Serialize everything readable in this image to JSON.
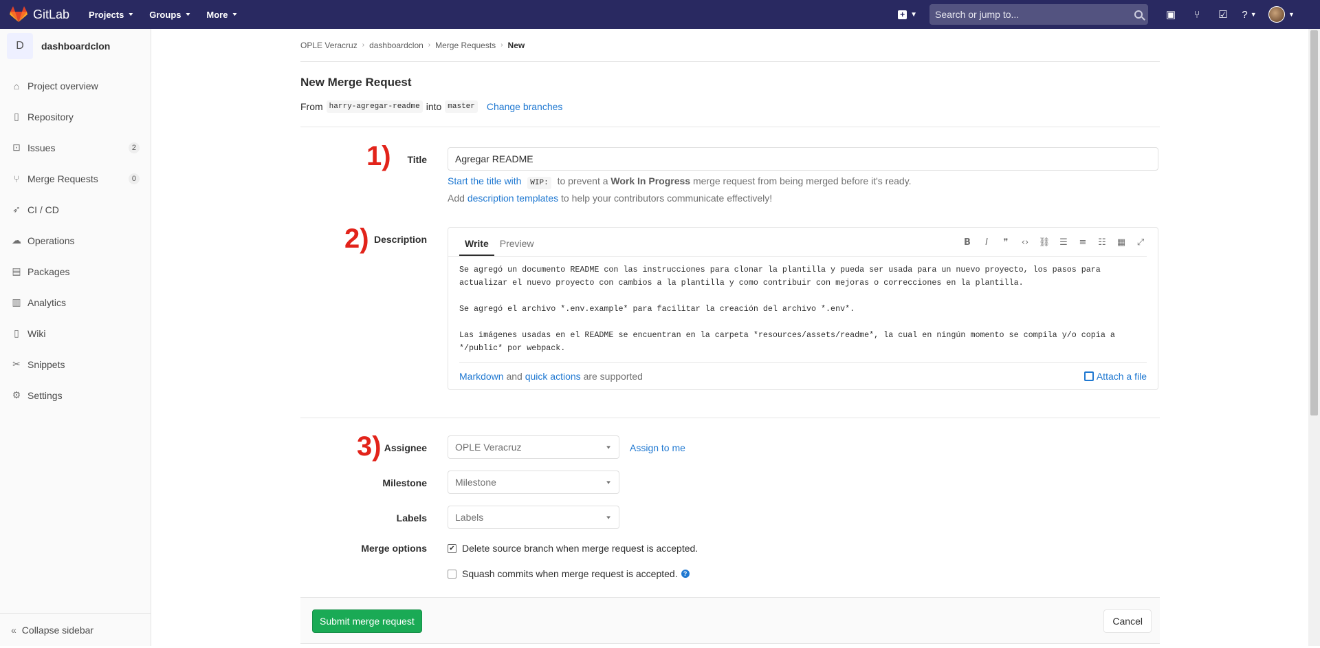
{
  "topbar": {
    "brand": "GitLab",
    "nav": [
      "Projects",
      "Groups",
      "More"
    ],
    "search_placeholder": "Search or jump to...",
    "colors": {
      "navbar": "#292961",
      "brand_orange": "#fc6d26"
    }
  },
  "sidebar": {
    "project_initial": "D",
    "project_name": "dashboardclon",
    "items": [
      {
        "label": "Project overview",
        "icon": "home-icon"
      },
      {
        "label": "Repository",
        "icon": "book-icon"
      },
      {
        "label": "Issues",
        "icon": "issues-icon",
        "count": "2"
      },
      {
        "label": "Merge Requests",
        "icon": "merge-request-icon",
        "count": "0"
      },
      {
        "label": "CI / CD",
        "icon": "rocket-icon"
      },
      {
        "label": "Operations",
        "icon": "cloud-icon"
      },
      {
        "label": "Packages",
        "icon": "package-icon"
      },
      {
        "label": "Analytics",
        "icon": "chart-icon"
      },
      {
        "label": "Wiki",
        "icon": "book-icon"
      },
      {
        "label": "Snippets",
        "icon": "scissors-icon"
      },
      {
        "label": "Settings",
        "icon": "gear-icon"
      }
    ],
    "collapse_label": "Collapse sidebar"
  },
  "breadcrumb": [
    "OPLE Veracruz",
    "dashboardclon",
    "Merge Requests",
    "New"
  ],
  "page": {
    "title": "New Merge Request",
    "from_label": "From",
    "source_branch": "harry-agregar-readme",
    "into_label": "into",
    "target_branch": "master",
    "change_branches": "Change branches"
  },
  "form": {
    "annotations": [
      "1)",
      "2)",
      "3)"
    ],
    "title_label": "Title",
    "title_value": "Agregar README",
    "wip_hint_link": "Start the title with",
    "wip_code": "WIP:",
    "wip_hint_mid": "to prevent a",
    "wip_hint_bold": "Work In Progress",
    "wip_hint_end": "merge request from being merged before it's ready.",
    "templates_pre": "Add",
    "templates_link": "description templates",
    "templates_post": "to help your contributors communicate effectively!",
    "description_label": "Description",
    "tab_write": "Write",
    "tab_preview": "Preview",
    "description_lines": [
      "Se agregó un documento README con las instrucciones para clonar la plantilla y pueda ser usada para un nuevo proyecto, los pasos para actualizar el nuevo proyecto con cambios a la plantilla y como contribuir con mejoras o correcciones en la plantilla.",
      "Se agregó el archivo *.env.example* para facilitar la creación del archivo *.env*.",
      "Las imágenes usadas en el README se encuentran en la carpeta *resources/assets/readme*, la cual en ningún momento se compila y/o copia a */public* por webpack."
    ],
    "markdown_link": "Markdown",
    "and_text": "and",
    "quick_actions_link": "quick actions",
    "supported_text": "are supported",
    "attach_label": "Attach a file",
    "assignee_label": "Assignee",
    "assignee_value": "OPLE Veracruz",
    "assign_to_me": "Assign to me",
    "milestone_label": "Milestone",
    "milestone_value": "Milestone",
    "labels_label": "Labels",
    "labels_value": "Labels",
    "merge_options_label": "Merge options",
    "option_delete": "Delete source branch when merge request is accepted.",
    "option_delete_checked": true,
    "option_squash": "Squash commits when merge request is accepted.",
    "option_squash_checked": false,
    "submit_label": "Submit merge request",
    "cancel_label": "Cancel"
  }
}
